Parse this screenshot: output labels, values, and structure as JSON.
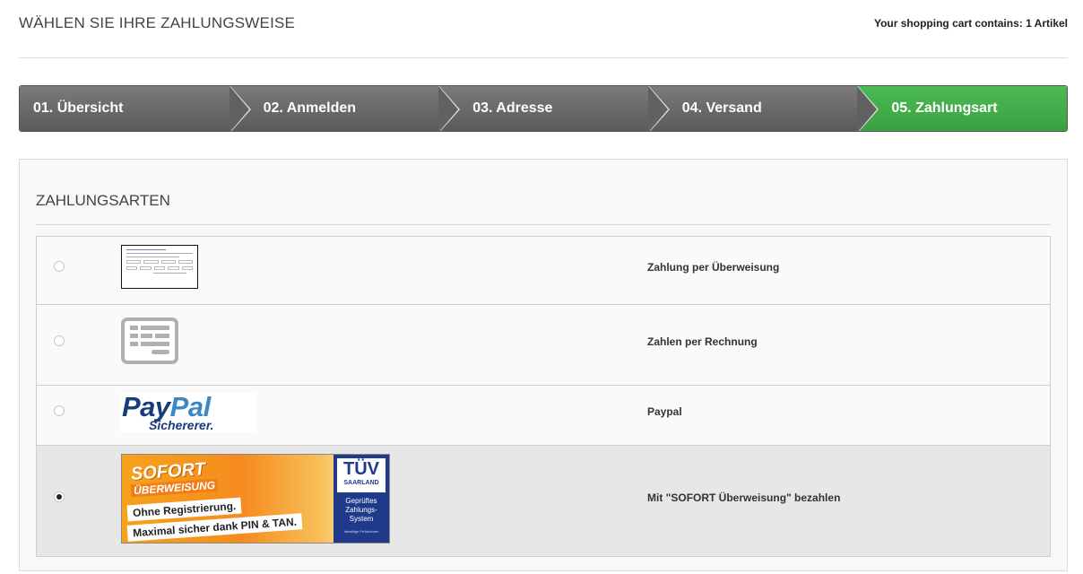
{
  "header": {
    "title": "WÄHLEN SIE IHRE ZAHLUNGSWEISE",
    "cart_info": "Your shopping cart contains: 1 Artikel"
  },
  "steps": [
    {
      "label": "01. Übersicht",
      "active": false
    },
    {
      "label": "02. Anmelden",
      "active": false
    },
    {
      "label": "03. Adresse",
      "active": false
    },
    {
      "label": "04. Versand",
      "active": false
    },
    {
      "label": "05. Zahlungsart",
      "active": true
    }
  ],
  "payment": {
    "section_title": "ZAHLUNGSARTEN",
    "methods": [
      {
        "label": "Zahlung per Überweisung",
        "selected": false,
        "icon": "bank-transfer-form-icon"
      },
      {
        "label": "Zahlen per Rechnung",
        "selected": false,
        "icon": "invoice-icon"
      },
      {
        "label": "Paypal",
        "selected": false,
        "icon": "paypal-logo"
      },
      {
        "label": "Mit \"SOFORT Überweisung\" bezahlen",
        "selected": true,
        "icon": "sofort-banner"
      }
    ],
    "paypal_logo": {
      "pay": "Pay",
      "pal": "Pal",
      "tagline": "Sichererer."
    },
    "sofort_banner": {
      "brand": "SOFORT",
      "brand_sub": "ÜBERWEISUNG",
      "line1": "Ohne Registrierung.",
      "line2": "Maximal sicher dank PIN & TAN.",
      "tuv_mark": "TÜV",
      "tuv_region": "SAARLAND",
      "tuv_cert": "Geprüftes Zahlungs-System",
      "tuv_foot": "freiwillige Prüfzeichen"
    }
  },
  "colors": {
    "step_inactive": "#666666",
    "step_active": "#42ad4a",
    "selected_row": "#e7e7e7"
  }
}
